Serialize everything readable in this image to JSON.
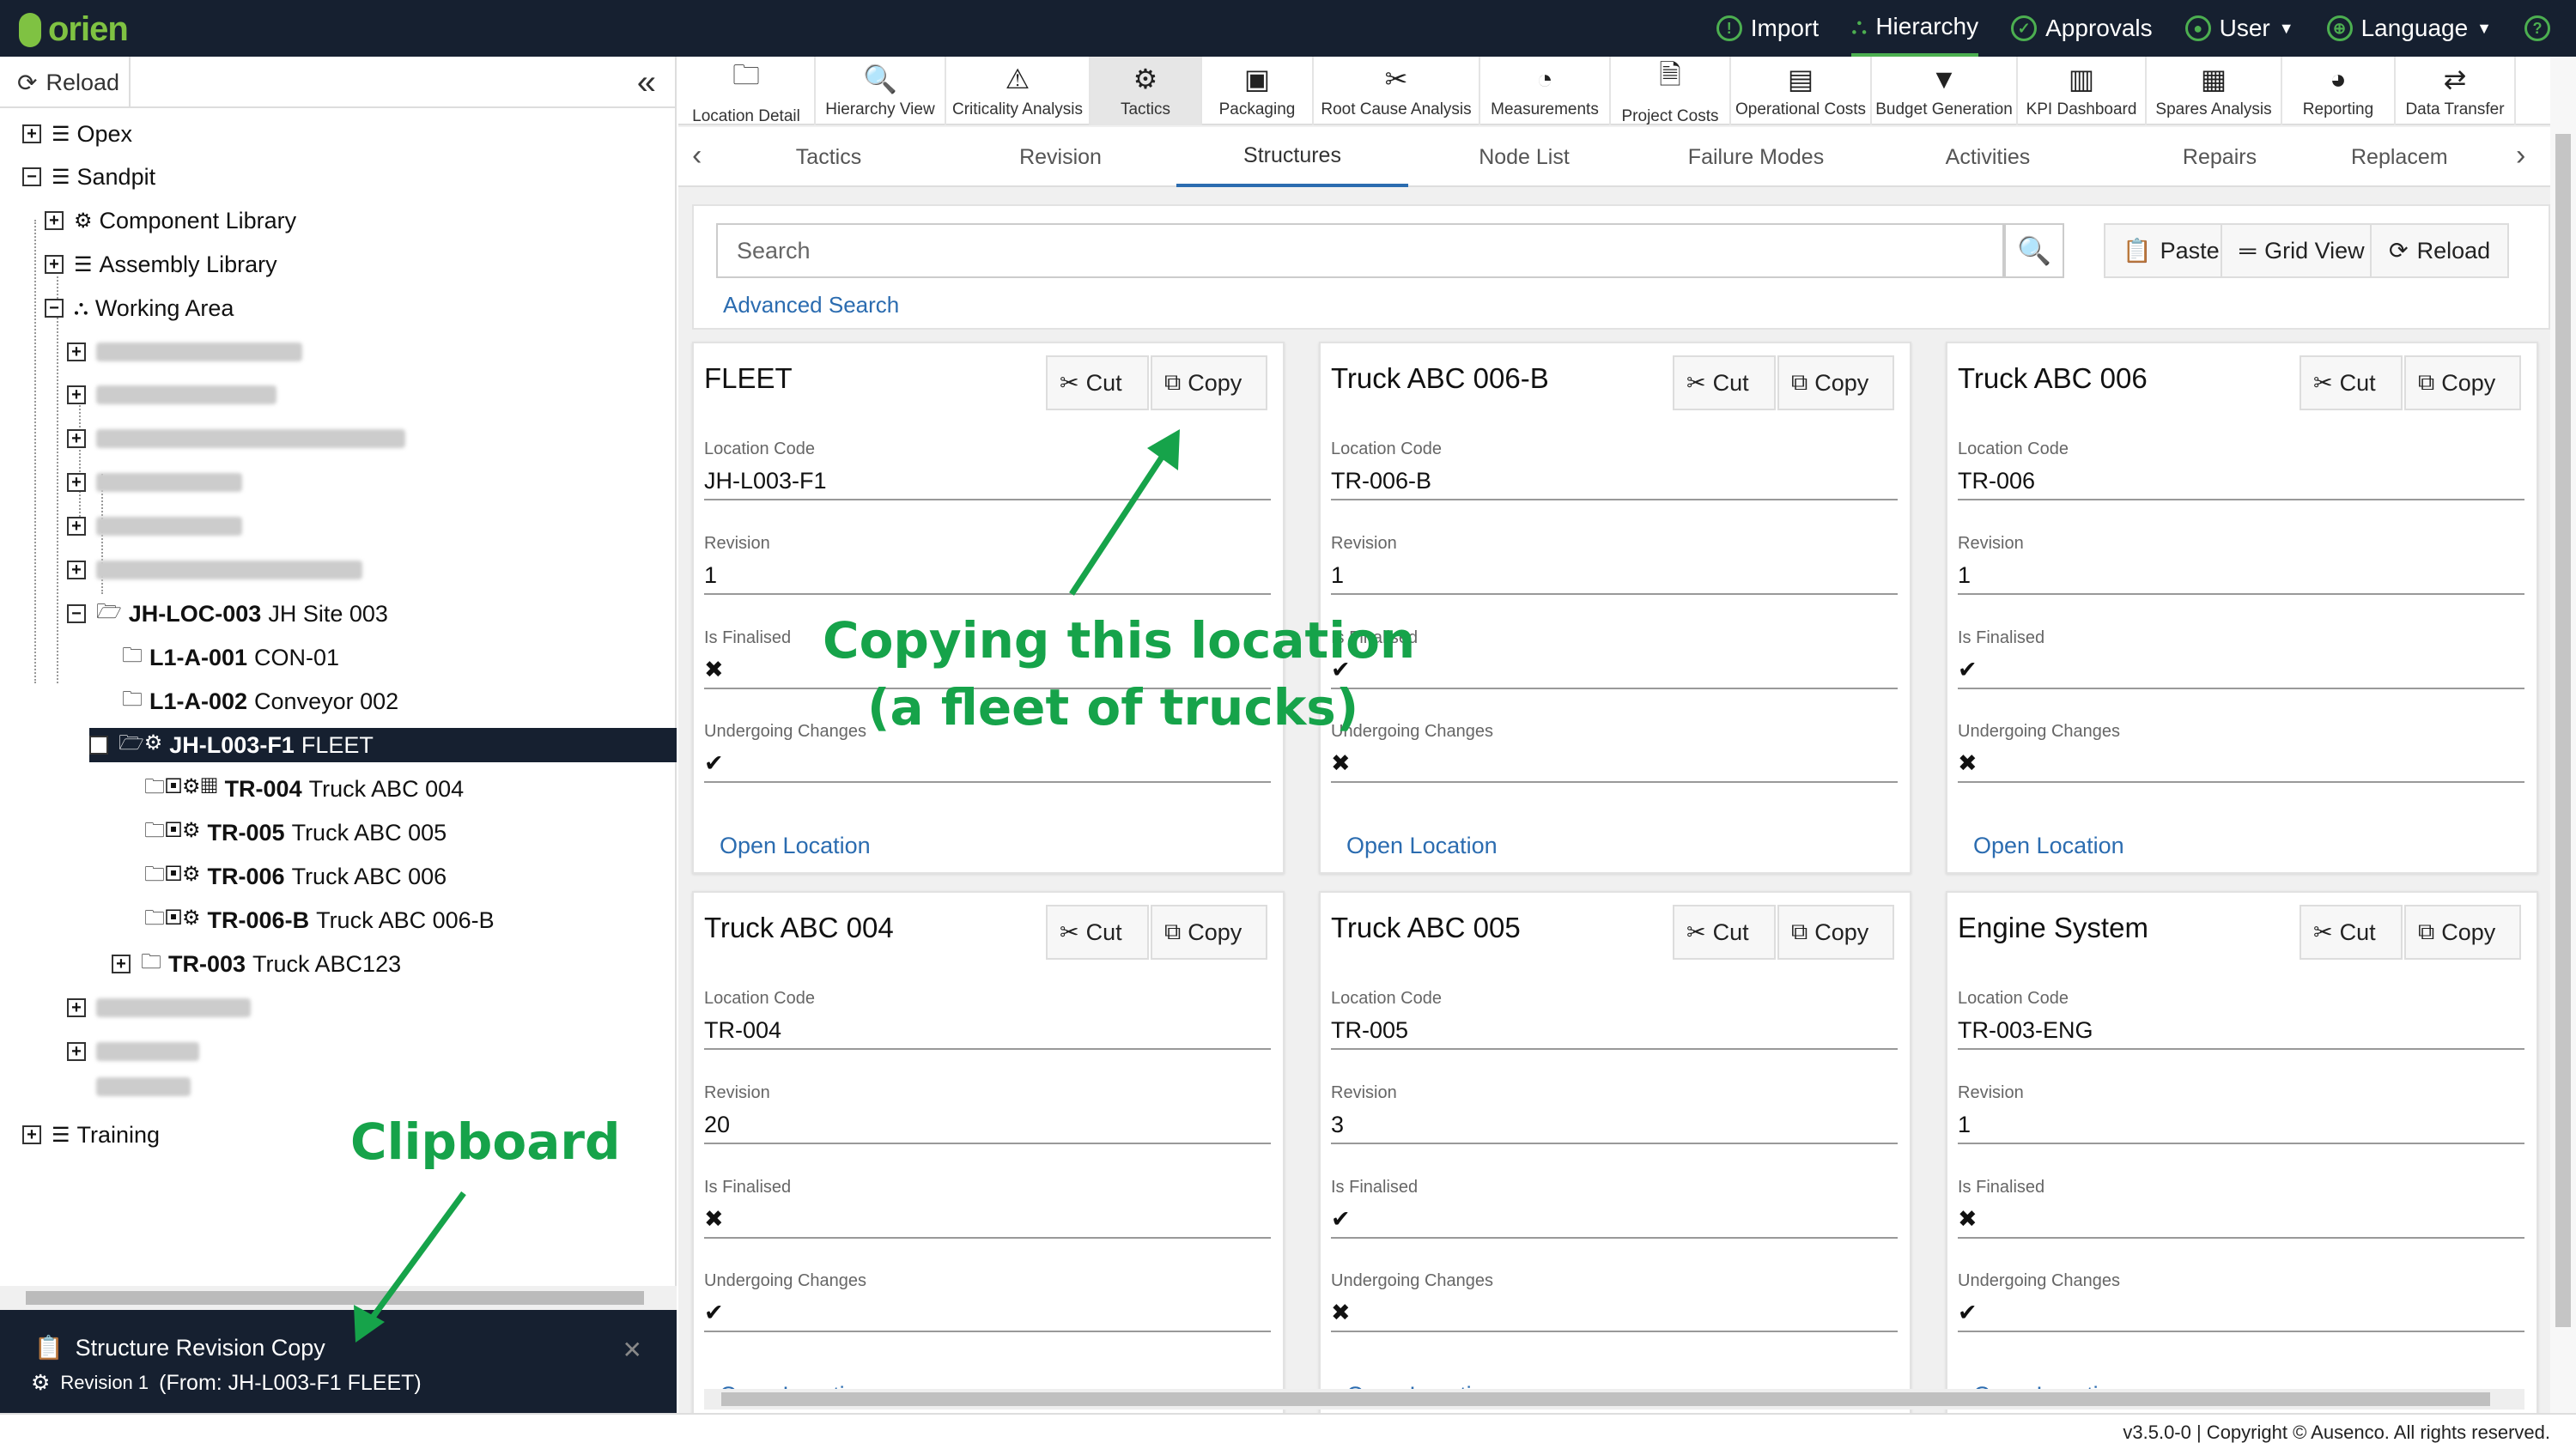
{
  "topbar": {
    "logo": "orien",
    "nav": [
      {
        "label": "Import",
        "icon": "lightbulb-icon"
      },
      {
        "label": "Hierarchy",
        "icon": "hierarchy-icon",
        "active": true
      },
      {
        "label": "Approvals",
        "icon": "check-circle-icon"
      },
      {
        "label": "User",
        "icon": "user-icon",
        "dropdown": true
      },
      {
        "label": "Language",
        "icon": "globe-icon",
        "dropdown": true
      },
      {
        "label": "",
        "icon": "help-icon"
      }
    ]
  },
  "sidebar": {
    "reload_label": "Reload",
    "tree": [
      {
        "label": "Opex",
        "icon": "database-icon",
        "expander": "+"
      },
      {
        "label": "Sandpit",
        "icon": "database-icon",
        "expander": "−"
      },
      {
        "label": "Component Library",
        "icon": "gear-icon",
        "expander": "+"
      },
      {
        "label": "Assembly Library",
        "icon": "database-icon",
        "expander": "+"
      },
      {
        "label": "Working Area",
        "icon": "sitemap-icon",
        "expander": "−"
      },
      {
        "code": "JH-LOC-003",
        "label": "JH Site 003",
        "icon": "folder-open-icon",
        "expander": "−"
      },
      {
        "code": "L1-A-001",
        "label": "CON-01",
        "icon": "folder-icon"
      },
      {
        "code": "L1-A-002",
        "label": "Conveyor 002",
        "icon": "folder-icon"
      },
      {
        "code": "JH-L003-F1",
        "label": "FLEET",
        "icon": "folder-open-icon",
        "expander": "−",
        "selected": true
      },
      {
        "code": "TR-004",
        "label": "Truck ABC 004",
        "icon": "folder-icon"
      },
      {
        "code": "TR-005",
        "label": "Truck ABC 005",
        "icon": "folder-icon"
      },
      {
        "code": "TR-006",
        "label": "Truck ABC 006",
        "icon": "folder-icon"
      },
      {
        "code": "TR-006-B",
        "label": "Truck ABC 006-B",
        "icon": "folder-icon"
      },
      {
        "code": "TR-003",
        "label": "Truck ABC123",
        "icon": "folder-icon",
        "expander": "+"
      },
      {
        "label": "Training",
        "icon": "database-icon",
        "expander": "+"
      }
    ],
    "clipboard": {
      "title": "Structure Revision Copy",
      "revision": "Revision 1",
      "source": "(From: JH-L003-F1 FLEET)"
    }
  },
  "toolbar": [
    {
      "label": "Location Detail",
      "icon": "folder-icon"
    },
    {
      "label": "Hierarchy View",
      "icon": "search-icon"
    },
    {
      "label": "Criticality Analysis",
      "icon": "warning-icon"
    },
    {
      "label": "Tactics",
      "icon": "gear-icon",
      "active": true
    },
    {
      "label": "Packaging",
      "icon": "package-icon"
    },
    {
      "label": "Root Cause Analysis",
      "icon": "tools-icon"
    },
    {
      "label": "Measurements",
      "icon": "gauge-icon"
    },
    {
      "label": "Project Costs",
      "icon": "file-dollar-icon"
    },
    {
      "label": "Operational Costs",
      "icon": "credit-card-icon"
    },
    {
      "label": "Budget Generation",
      "icon": "filter-dollar-icon"
    },
    {
      "label": "KPI Dashboard",
      "icon": "bar-chart-icon"
    },
    {
      "label": "Spares Analysis",
      "icon": "pallet-icon"
    },
    {
      "label": "Reporting",
      "icon": "pie-chart-icon"
    },
    {
      "label": "Data Transfer",
      "icon": "transfer-icon"
    }
  ],
  "tabs": [
    "Tactics",
    "Revision",
    "Structures",
    "Node List",
    "Failure Modes",
    "Activities",
    "Repairs",
    "Replacem"
  ],
  "active_tab": "Structures",
  "search": {
    "placeholder": "Search",
    "advanced_label": "Advanced Search"
  },
  "actions": {
    "paste": "Paste",
    "grid_view": "Grid View",
    "reload": "Reload"
  },
  "card_labels": {
    "cut": "Cut",
    "copy": "Copy",
    "location_code": "Location Code",
    "revision": "Revision",
    "is_finalised": "Is Finalised",
    "undergoing_changes": "Undergoing Changes",
    "open_location": "Open Location"
  },
  "cards": [
    {
      "title": "FLEET",
      "location_code": "JH-L003-F1",
      "revision": "1",
      "is_finalised": "✖",
      "undergoing_changes": "✔"
    },
    {
      "title": "Truck ABC 006-B",
      "location_code": "TR-006-B",
      "revision": "1",
      "is_finalised": "✔",
      "undergoing_changes": "✖"
    },
    {
      "title": "Truck ABC 006",
      "location_code": "TR-006",
      "revision": "1",
      "is_finalised": "✔",
      "undergoing_changes": "✖"
    },
    {
      "title": "Truck ABC 004",
      "location_code": "TR-004",
      "revision": "20",
      "is_finalised": "✖",
      "undergoing_changes": "✔"
    },
    {
      "title": "Truck ABC 005",
      "location_code": "TR-005",
      "revision": "3",
      "is_finalised": "✔",
      "undergoing_changes": "✖"
    },
    {
      "title": "Engine System",
      "location_code": "TR-003-ENG",
      "revision": "1",
      "is_finalised": "✖",
      "undergoing_changes": "✔"
    }
  ],
  "annotations": {
    "copy_note_line1": "Copying this location",
    "copy_note_line2": "(a fleet of trucks)",
    "clipboard_note": "Clipboard"
  },
  "footer": "v3.5.0-0 | Copyright © Ausenco. All rights reserved."
}
